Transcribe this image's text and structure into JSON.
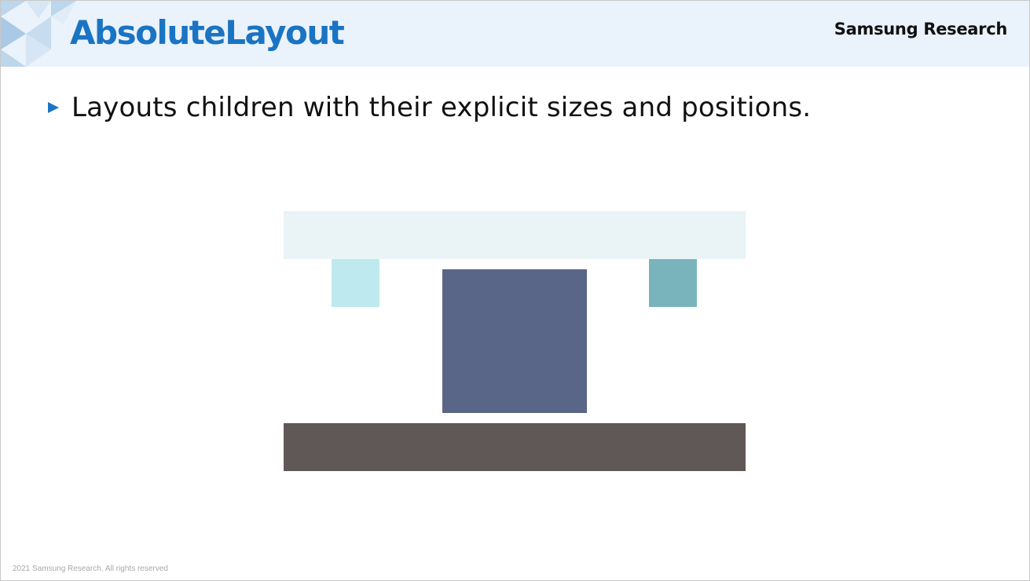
{
  "slide": {
    "title": "AbsoluteLayout",
    "brand": "Samsung Research",
    "bullet_text": "Layouts children with their explicit sizes and positions.",
    "copyright": "2021 Samsung Research. All rights reserved"
  },
  "icons": {
    "bullet": "triangle-right-icon",
    "corner": "triangle-pattern-decoration"
  },
  "colors": {
    "header_band": "#eaf2fb",
    "title": "#1a74c3",
    "bullet": "#1a74c3",
    "top_bar": "#eaf3f6",
    "small_box_left": "#bee9ee",
    "small_box_right": "#79b4bd",
    "center_box": "#5a6688",
    "bottom_bar": "#605757"
  }
}
